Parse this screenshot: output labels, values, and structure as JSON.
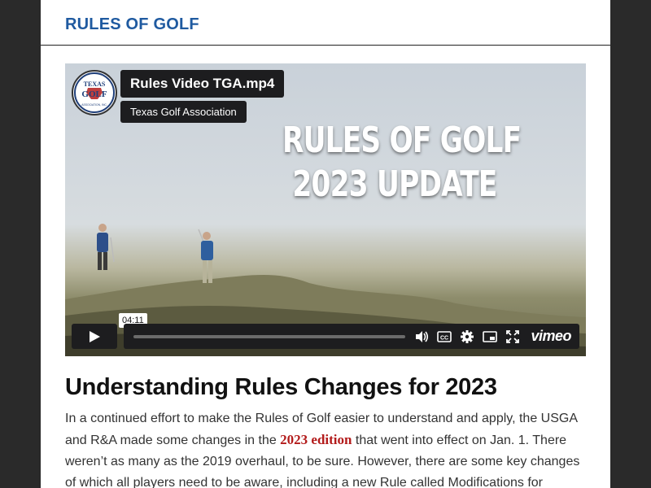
{
  "header": {
    "title": "RULES OF GOLF"
  },
  "video": {
    "title": "Rules Video TGA.mp4",
    "owner": "Texas Golf Association",
    "overlay_line1": "RULES OF GOLF",
    "overlay_line2": "2023 UPDATE",
    "logo_text_top": "TEXAS",
    "logo_text_mid": "GOLF",
    "logo_text_bottom": "ASSOCIATION, INC.",
    "duration": "04:11",
    "progress": 0,
    "brand": "vimeo"
  },
  "article": {
    "heading": "Understanding Rules Changes for 2023",
    "paragraph_before_link": "In a continued effort to make the Rules of Golf easier to understand and apply, the USGA and R&A made some changes in the ",
    "link_text": "2023 edition",
    "paragraph_after_link": " that went into effect on Jan. 1. There weren’t as many as the 2019 overhaul, to be sure. However, there are some key changes of which all players need to be aware, including a new Rule called Modifications for"
  },
  "colors": {
    "title_blue": "#1f5aa0",
    "link_red": "#b31b1b",
    "control_bg": "#1d1d1f"
  }
}
